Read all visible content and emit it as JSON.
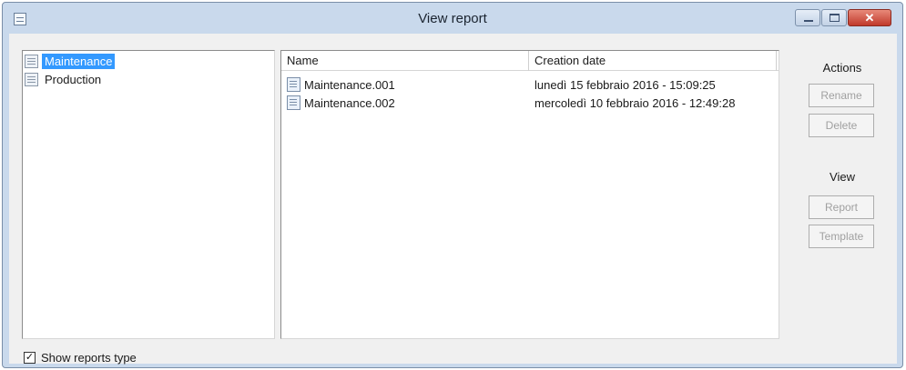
{
  "window": {
    "title": "View report",
    "close_glyph": "✕"
  },
  "tree": {
    "items": [
      {
        "label": "Maintenance",
        "selected": true
      },
      {
        "label": "Production",
        "selected": false
      }
    ]
  },
  "list": {
    "columns": [
      "Name",
      "Creation date"
    ],
    "rows": [
      {
        "name": "Maintenance.001",
        "date": "lunedì 15 febbraio 2016 - 15:09:25"
      },
      {
        "name": "Maintenance.002",
        "date": "mercoledì 10 febbraio 2016 - 12:49:28"
      }
    ]
  },
  "actions": {
    "label": "Actions",
    "rename": "Rename",
    "delete": "Delete"
  },
  "view": {
    "label": "View",
    "report": "Report",
    "template": "Template"
  },
  "options": {
    "show_reports_type": "Show reports type",
    "show_reports_type_checked": true,
    "check_glyph": "✓"
  },
  "colors": {
    "selection": "#3399ff",
    "title_bar": "#c9d9ec",
    "close_button": "#c0392b"
  }
}
